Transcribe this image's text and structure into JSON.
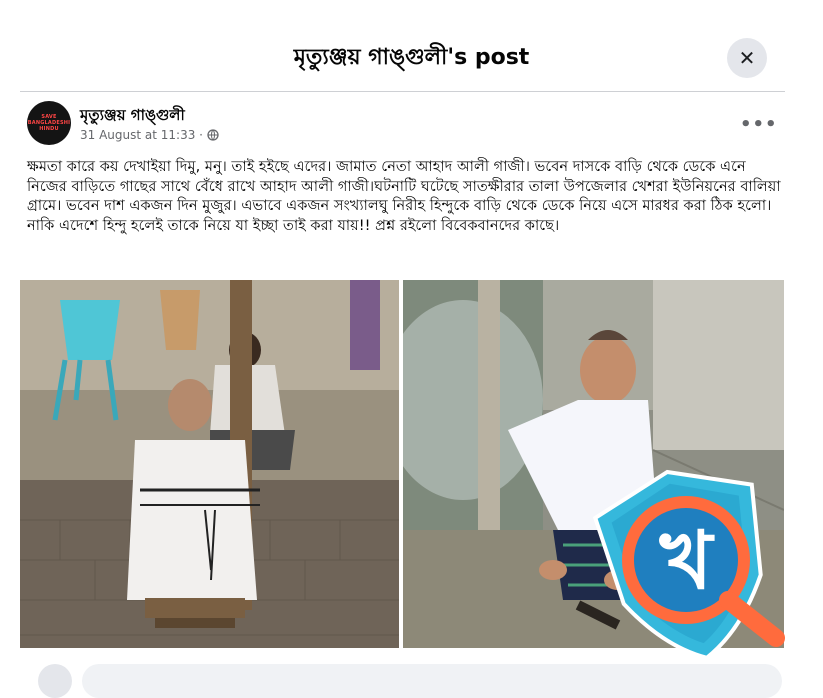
{
  "dialog": {
    "title": "মৃত্যুঞ্জয় গাঙ্গুলী's post",
    "close_symbol": "✕"
  },
  "post": {
    "author": "মৃত্যুঞ্জয় গাঙ্গুলী",
    "avatar_text": "SAVE BANGLADESHI HINDU",
    "date": "31 August at 11:33 ·",
    "privacy_icon": "globe-icon",
    "more_symbol": "•••",
    "text": "ক্ষমতা কারে কয় দেখাইয়া দিমু, মনু। তাই হইছে এদের। জামাত নেতা আহাদ আলী গাজী। ভবেন দাসকে বাড়ি থেকে ডেকে এনে নিজের বাড়িতে গাছের সাথে বেঁধে রাখে আহাদ আলী গাজী।ঘটনাটি ঘটেছে সাতক্ষীরার তালা উপজেলার খেশরা ইউনিয়নের বালিয়া গ্রামে। ভবেন দাশ একজন দিন মুজুর। এভাবে একজন সংখ্যালঘু নিরীহ হিন্দুকে বাড়ি থেকে ডেকে নিয়ে এসে মারধর করা ঠিক হলো। নাকি এদেশে হিন্দু হলেই তাকে নিয়ে যা ইচ্ছা তাই করা যায়!! প্রশ্ন রইলো বিবেকবানদের কাছে।"
  },
  "watermark": {
    "letter": "খ",
    "colors": {
      "shield": "#2bb5d8",
      "ring": "#ff6b3d",
      "center": "#1f7fbf"
    }
  }
}
